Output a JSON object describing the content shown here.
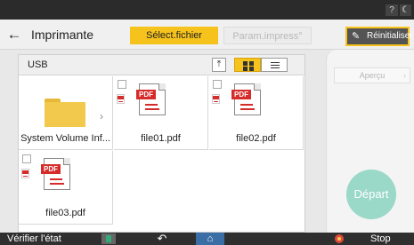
{
  "status_bar": {
    "help_icon": "question-icon",
    "help_text": "?",
    "moon_icon": "moon-icon",
    "moon_text": "☾"
  },
  "header": {
    "back_icon": "back-arrow-icon",
    "back_text": "←",
    "title": "Imprimante",
    "tabs": [
      {
        "label": "Sélect.fichier",
        "active": true
      },
      {
        "label": "Param.impress°",
        "active": false
      }
    ],
    "reset_label": "Réinitialiser",
    "reset_icon": "pencil-icon",
    "reset_icon_text": "✎",
    "accent_color": "#f6c21c"
  },
  "file_panel": {
    "title": "USB",
    "up_icon": "folder-up-icon",
    "up_text": "⤒",
    "view_modes": [
      {
        "name": "grid",
        "icon": "grid-view-icon",
        "active": true
      },
      {
        "name": "list",
        "icon": "list-view-icon",
        "active": false
      }
    ],
    "items": [
      {
        "name": "System Volume Inf...",
        "type": "folder",
        "chevron": "›"
      },
      {
        "name": "file01.pdf",
        "type": "pdf",
        "badge": "PDF"
      },
      {
        "name": "file02.pdf",
        "type": "pdf",
        "badge": "PDF"
      },
      {
        "name": "file03.pdf",
        "type": "pdf",
        "badge": "PDF"
      }
    ]
  },
  "side_panel": {
    "preview_label": "Aperçu",
    "preview_arrow": "›",
    "start_label": "Départ",
    "start_color": "#9ad8c8"
  },
  "bottom_bar": {
    "check_status_label": "Vérifier l'état",
    "back_text": "↶",
    "home_text": "⌂",
    "stop_label": "Stop"
  }
}
